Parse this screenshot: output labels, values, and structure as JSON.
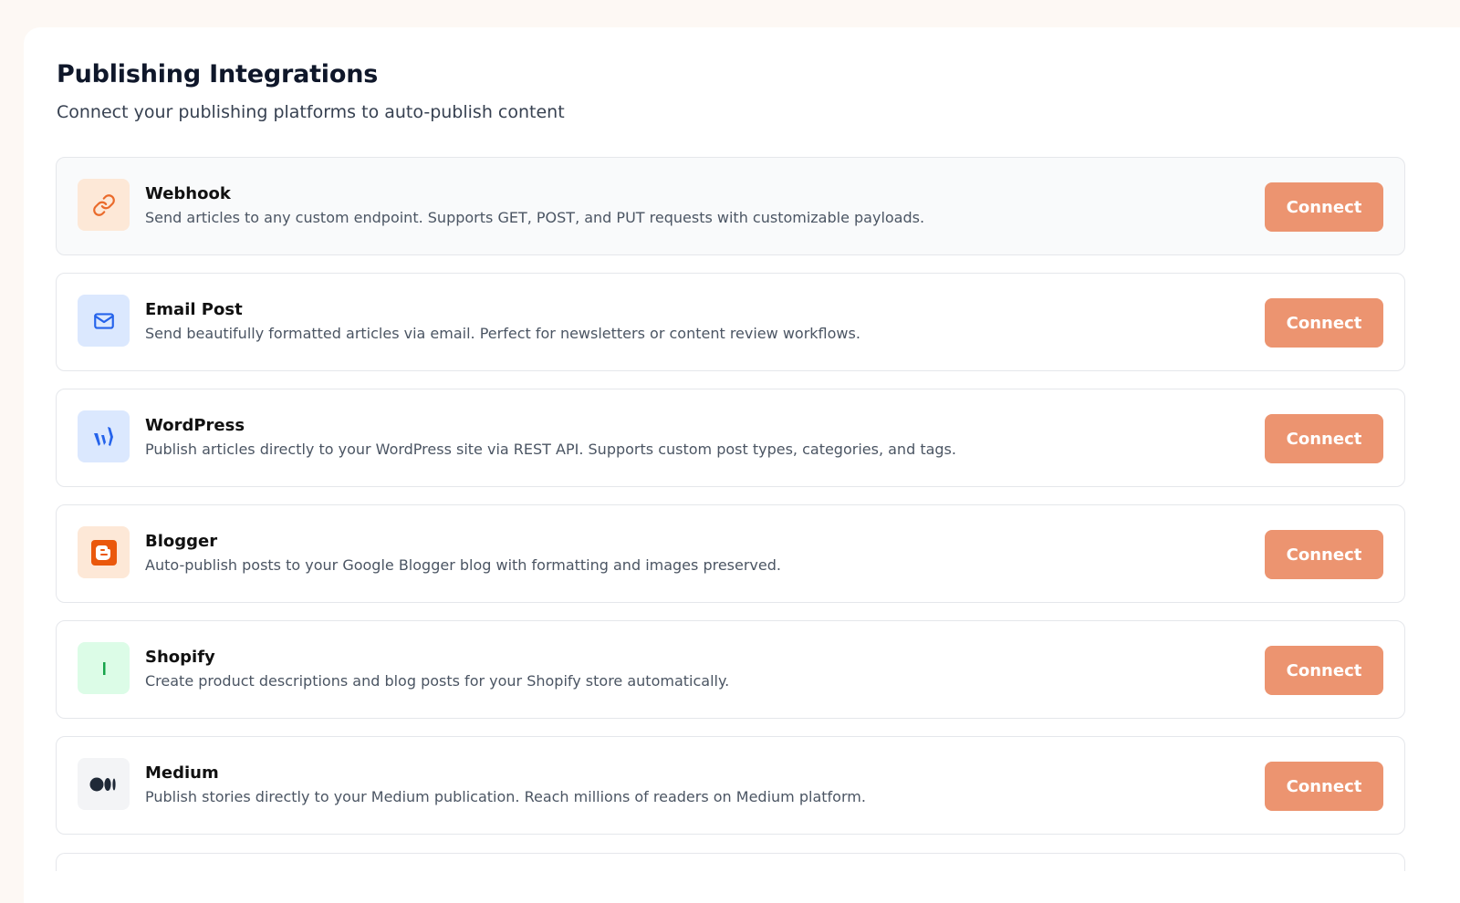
{
  "header": {
    "title": "Publishing Integrations",
    "subtitle": "Connect your publishing platforms to auto-publish content"
  },
  "integrations": [
    {
      "name": "Webhook",
      "description": "Send articles to any custom endpoint. Supports GET, POST, and PUT requests with customizable payloads.",
      "button": "Connect",
      "icon": "link-icon",
      "icon_bg": "#fde8d7",
      "icon_color": "#ea6a2a"
    },
    {
      "name": "Email Post",
      "description": "Send beautifully formatted articles via email. Perfect for newsletters or content review workflows.",
      "button": "Connect",
      "icon": "mail-icon",
      "icon_bg": "#dbe8fe",
      "icon_color": "#2563eb"
    },
    {
      "name": "WordPress",
      "description": "Publish articles directly to your WordPress site via REST API. Supports custom post types, categories, and tags.",
      "button": "Connect",
      "icon": "wordpress-icon",
      "icon_bg": "#dbe8fe",
      "icon_color": "#2563eb"
    },
    {
      "name": "Blogger",
      "description": "Auto-publish posts to your Google Blogger blog with formatting and images preserved.",
      "button": "Connect",
      "icon": "blogger-icon",
      "icon_bg": "#fde8d7",
      "icon_color": "#ea580c"
    },
    {
      "name": "Shopify",
      "description": "Create product descriptions and blog posts for your Shopify store automatically.",
      "button": "Connect",
      "icon": "shopify-icon",
      "icon_bg": "#dcfce7",
      "icon_color": "#16a34a"
    },
    {
      "name": "Medium",
      "description": "Publish stories directly to your Medium publication. Reach millions of readers on Medium platform.",
      "button": "Connect",
      "icon": "medium-icon",
      "icon_bg": "#f3f4f6",
      "icon_color": "#1f2937"
    }
  ],
  "colors": {
    "accent_button": "#ec9470",
    "page_background": "#fdf8f4"
  }
}
